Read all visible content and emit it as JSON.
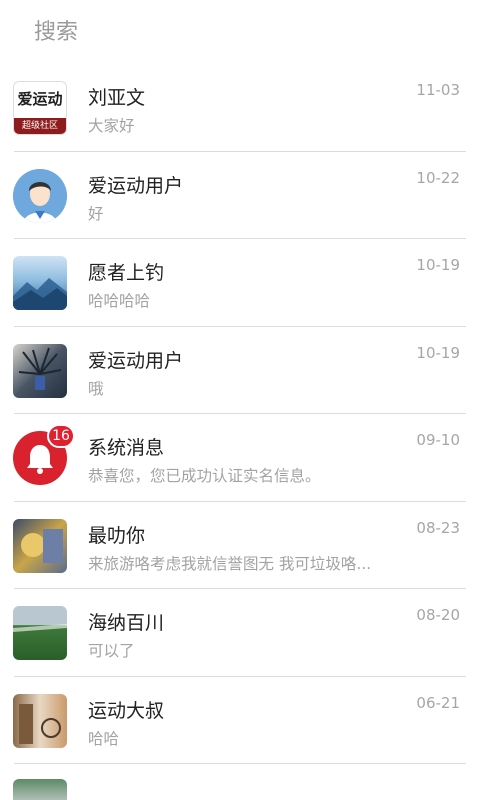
{
  "search": {
    "placeholder": "搜索"
  },
  "messages": [
    {
      "name": "刘亚文",
      "preview": "大家好",
      "date": "11-03",
      "logo_top": "爱运动",
      "logo_bottom": "超级社区"
    },
    {
      "name": "爱运动用户",
      "preview": "好",
      "date": "10-22"
    },
    {
      "name": "愿者上钓",
      "preview": "哈哈哈哈",
      "date": "10-19"
    },
    {
      "name": "爱运动用户",
      "preview": "哦",
      "date": "10-19"
    },
    {
      "name": "系统消息",
      "preview": "恭喜您，您已成功认证实名信息。",
      "date": "09-10",
      "badge": "16"
    },
    {
      "name": "最叻你",
      "preview": "来旅游咯考虑我就信誉图无 我可垃圾咯...",
      "date": "08-23"
    },
    {
      "name": "海纳百川",
      "preview": "可以了",
      "date": "08-20"
    },
    {
      "name": "运动大叔",
      "preview": "哈哈",
      "date": "06-21"
    }
  ],
  "colors": {
    "badge": "#e0212f",
    "divider": "#dcdcdc",
    "muted": "#a3a3a3"
  }
}
